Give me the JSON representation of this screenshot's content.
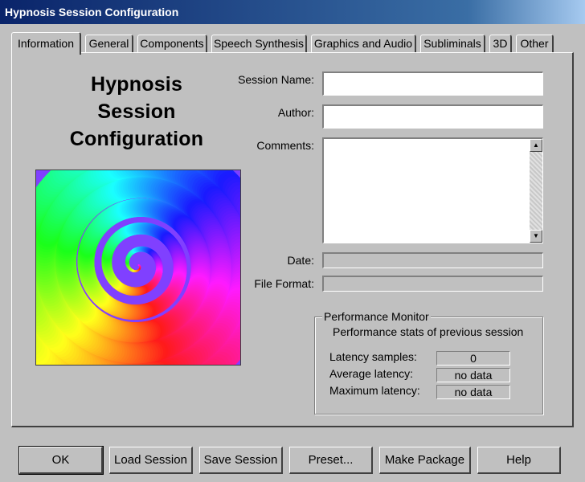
{
  "window": {
    "title": "Hypnosis Session Configuration"
  },
  "tabs": [
    {
      "label": "Information",
      "active": true
    },
    {
      "label": "General"
    },
    {
      "label": "Components"
    },
    {
      "label": "Speech Synthesis"
    },
    {
      "label": "Graphics and Audio"
    },
    {
      "label": "Subliminals"
    },
    {
      "label": "3D"
    },
    {
      "label": "Other"
    }
  ],
  "info": {
    "heading_lines": [
      "Hypnosis",
      "Session",
      "Configuration"
    ],
    "spiral_image": "rainbow-spiral-image"
  },
  "form": {
    "session_name": {
      "label": "Session Name:",
      "value": ""
    },
    "author": {
      "label": "Author:",
      "value": ""
    },
    "comments": {
      "label": "Comments:",
      "value": ""
    },
    "date": {
      "label": "Date:",
      "value": ""
    },
    "file_format": {
      "label": "File Format:",
      "value": ""
    }
  },
  "performance": {
    "group_title": "Performance Monitor",
    "subtitle": "Performance stats of previous session",
    "latency_samples": {
      "label": "Latency samples:",
      "value": "0"
    },
    "average_latency": {
      "label": "Average latency:",
      "value": "no data"
    },
    "maximum_latency": {
      "label": "Maximum latency:",
      "value": "no data"
    }
  },
  "buttons": {
    "ok": "OK",
    "load_session": "Load Session",
    "save_session": "Save Session",
    "preset": "Preset...",
    "make_package": "Make Package",
    "help": "Help"
  },
  "colors": {
    "title_bar": "#0a246a",
    "face": "#c0c0c0"
  }
}
